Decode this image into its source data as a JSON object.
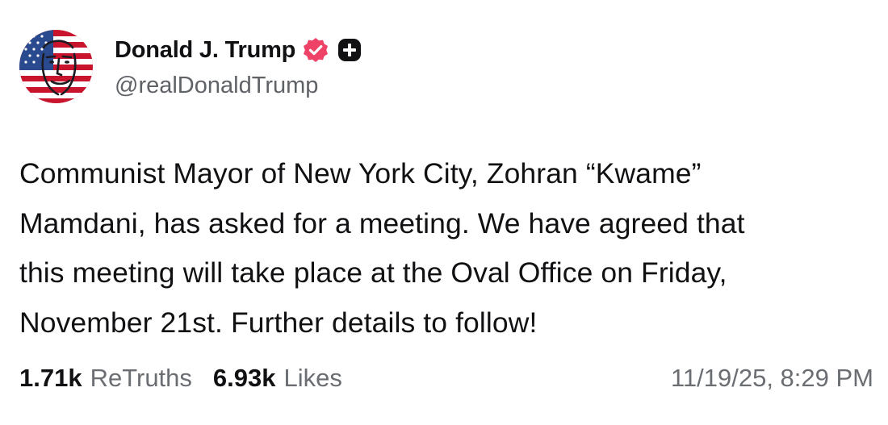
{
  "author": {
    "name": "Donald J. Trump",
    "handle": "@realDonaldTrump",
    "verified_badge_icon": "verified-badge-icon",
    "badge_color": "#ee4266",
    "plus_icon": "plus-badge-icon"
  },
  "post": {
    "text": "Communist Mayor of New York City, Zohran “Kwame”\nMamdani, has asked for a meeting. We have agreed that\nthis meeting will take place at the Oval Office on Friday,\nNovember 21st. Further details to follow!"
  },
  "stats": {
    "retruths_count": "1.71k",
    "retruths_label": "ReTruths",
    "likes_count": "6.93k",
    "likes_label": "Likes"
  },
  "timestamp": "11/19/25, 8:29 PM"
}
